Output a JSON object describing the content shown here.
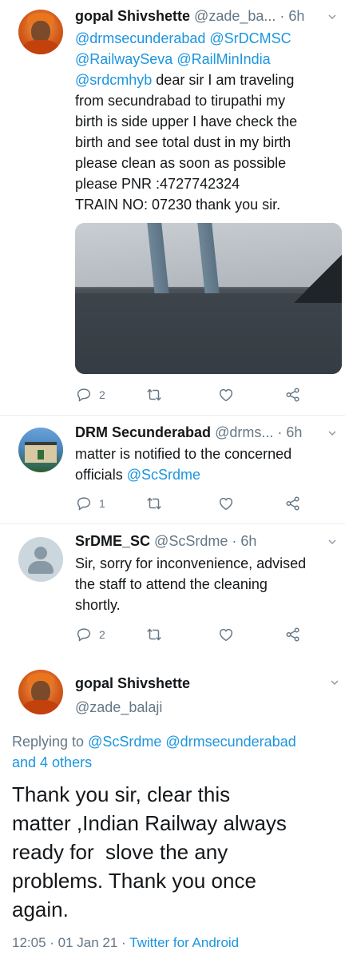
{
  "tweets": [
    {
      "name": "gopal Shivshette",
      "handle": "@zade_ba...",
      "sep": " · ",
      "time": "6h",
      "mentions_line1": "@drmsecunderabad @SrDCMSC",
      "mentions_line2": "@RailwaySeva @RailMinIndia",
      "mention_lead": "@srdcmhyb",
      "text_after_mention": " dear sir I am traveling",
      "lines": [
        "from secundrabad to tirupathi my",
        "birth is side upper I have check the",
        "birth and see total dust in my birth",
        "please clean as soon as possible",
        "please PNR :4727742324",
        "TRAIN NO: 07230 thank you sir."
      ],
      "replies": "2",
      "retweets": "",
      "likes": ""
    },
    {
      "name": "DRM Secunderabad",
      "handle": "@drms...",
      "sep": " · ",
      "time": "6h",
      "line1": "matter is notified to the concerned",
      "line2_prefix": "officials ",
      "line2_mention": "@ScSrdme",
      "replies": "1"
    },
    {
      "name": "SrDME_SC",
      "handle": "@ScSrdme",
      "sep": " · ",
      "time": "6h",
      "lines": [
        "Sir, sorry for inconvenience, advised",
        "the staff to attend the cleaning",
        "shortly."
      ],
      "replies": "2"
    }
  ],
  "main_tweet": {
    "name": "gopal Shivshette",
    "handle": "@zade_balaji",
    "replying_prefix": "Replying to ",
    "replying_mention1": "@ScSrdme",
    "replying_mention2": " @drmsecunderabad",
    "replying_others": "and 4 others",
    "lines": [
      "Thank you sir, clear this",
      "matter ,Indian Railway always",
      "ready for  slove the any",
      "problems. Thank you once",
      "again."
    ],
    "timestamp": "12:05 · 01 Jan 21 · ",
    "source": "Twitter for Android"
  },
  "colors": {
    "link": "#1b95e0",
    "muted": "#657786",
    "text": "#14171a"
  },
  "icons": [
    "reply-icon",
    "retweet-icon",
    "like-icon",
    "share-icon",
    "chevron-down-icon"
  ]
}
